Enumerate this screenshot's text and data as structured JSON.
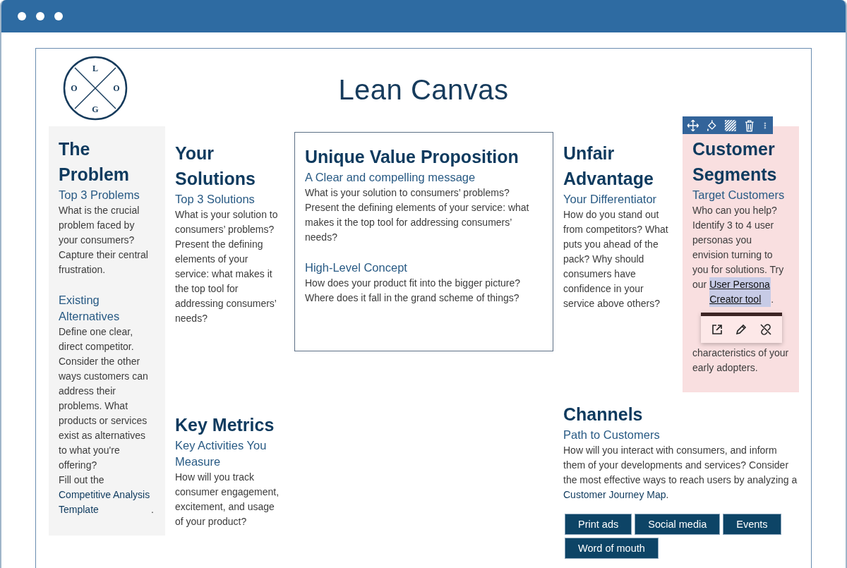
{
  "logo": {
    "letters": [
      "L",
      "O",
      "O",
      "G"
    ]
  },
  "title": "Lean Canvas",
  "blocks": [
    {
      "kind": "problem",
      "title": "The Problem",
      "color": "#f4f4f4",
      "selected": false,
      "sections": [
        {
          "subtitle": "Top 3 Problems",
          "paragraphs": [
            {
              "text": "What is the crucial problem faced by your consumers? Capture their central frustration."
            }
          ]
        },
        {
          "subtitle": "Existing Alternatives",
          "paragraphs": [
            {
              "text": "Define one clear, direct competitor. Consider the other ways customers can address their problems. What products or services exist as alternatives to what you're offering?"
            },
            {
              "text": "Fill out the",
              "link": "Competitive Analysis Template",
              "after": ".",
              "link_selected": false
            }
          ]
        }
      ]
    },
    {
      "kind": "solution",
      "title": "Your Solutions",
      "selected": false,
      "sections": [
        {
          "subtitle": "Top 3 Solutions",
          "paragraphs": [
            {
              "text": "What is your solution to consumers’ problems? Present the defining elements of your service: what makes it the top tool for addressing consumers’ needs?"
            }
          ]
        }
      ]
    },
    {
      "kind": "uvp",
      "title": "Unique Value Proposition",
      "selected": false,
      "sections": [
        {
          "subtitle": "A Clear and compelling message",
          "paragraphs": [
            {
              "text": "What is your solution to consumers’ problems? Present the defining elements of your service: what makes it the top tool for addressing consumers’ needs?"
            }
          ]
        },
        {
          "subtitle": "High-Level Concept",
          "paragraphs": [
            {
              "text": "How does your product fit into the bigger picture? Where does it fall in the grand scheme of things?"
            }
          ]
        }
      ]
    },
    {
      "kind": "advantage",
      "title": "Unfair Advantage",
      "selected": false,
      "sections": [
        {
          "subtitle": "Your Differentiator",
          "paragraphs": [
            {
              "text": "How do you stand out from competitors? What puts you ahead of the pack? Why should consumers have confidence in your service above others?"
            }
          ]
        }
      ]
    },
    {
      "kind": "segments",
      "title": "Customer Segments",
      "color": "#f9dfe0",
      "selected": true,
      "sections": [
        {
          "subtitle": "Target Customers",
          "paragraphs": [
            {
              "text": "Who can you help? Identify 3 to 4 user personas you envision turning to you for solutions. Try our",
              "link": "User Persona Creator tool",
              "after": ".",
              "link_selected": true
            },
            {
              "text": "characteristics of your early adopters."
            }
          ]
        }
      ]
    },
    {
      "kind": "metrics",
      "title": "Key Metrics",
      "selected": false,
      "sections": [
        {
          "subtitle": "Key Activities You Measure",
          "paragraphs": [
            {
              "text": "How will you track consumer engagement, excitement, and usage of your product?"
            }
          ]
        }
      ]
    },
    {
      "kind": "channels",
      "title": "Channels",
      "selected": false,
      "sections": [
        {
          "subtitle": "Path to Customers",
          "paragraphs": [
            {
              "text": "How will you interact with consumers, and inform them of your developments and services? Consider the most effective ways to reach users by analyzing a",
              "link": "Customer Journey Map",
              "after": ".",
              "link_selected": false
            }
          ]
        }
      ],
      "tags": [
        "Print ads",
        "Social media",
        "Events",
        "Word of mouth"
      ]
    }
  ]
}
